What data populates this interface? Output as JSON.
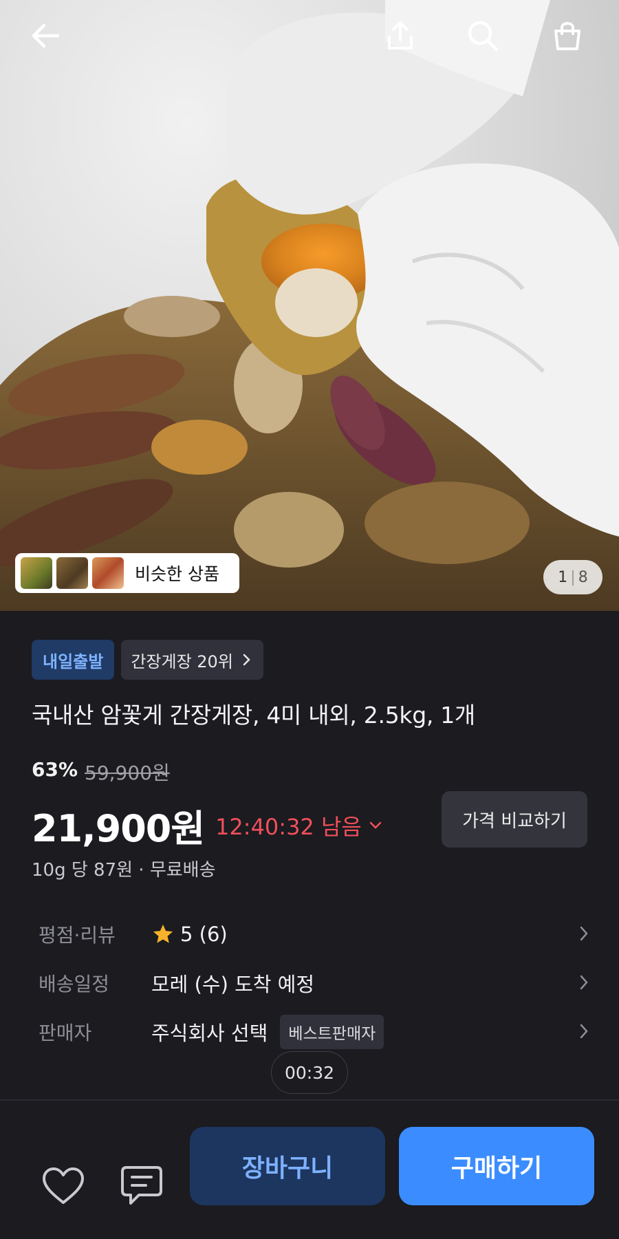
{
  "gallery": {
    "similar_label": "비슷한 상품",
    "counter_current": "1",
    "counter_total": "8"
  },
  "topbar": {
    "icons": [
      "back-arrow-icon",
      "share-icon",
      "search-icon",
      "shopping-bag-icon"
    ]
  },
  "product": {
    "badge_delivery": "내일출발",
    "badge_rank": "간장게장 20위",
    "title": "국내산 암꽃게 간장게장, 4미 내외, 2.5kg, 1개",
    "discount_rate": "63%",
    "original_price": "59,900원",
    "price": "21,900원",
    "timer": "12:40:32 남음",
    "compare_label": "가격 비교하기",
    "unit_price": "10g 당 87원 · 무료배송"
  },
  "info": {
    "rating_label": "평점·리뷰",
    "rating_value": "5 (6)",
    "delivery_label": "배송일정",
    "delivery_value": "모레 (수) 도착 예정",
    "seller_label": "판매자",
    "seller_value": "주식회사 선택",
    "seller_badge": "베스트판매자"
  },
  "video_time": "00:32",
  "bottom": {
    "cart_label": "장바구니",
    "buy_label": "구매하기"
  },
  "colors": {
    "background": "#1b1b20",
    "accent_blue": "#3b8dff",
    "timer_red": "#f0505a",
    "star": "#f6b22a"
  }
}
